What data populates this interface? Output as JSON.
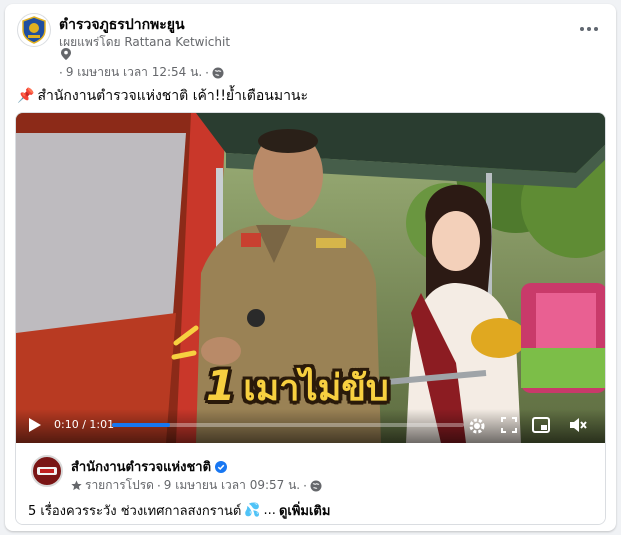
{
  "post": {
    "page_name": "ตำรวจภูธรปากพะยูน",
    "publisher": "เผยแพร่โดย Rattana Ketwichit",
    "date": "9 เมษายน เวลา 12:54 น.",
    "separator": "·",
    "pin_emoji": "📌",
    "text": "สำนักงานตำรวจแห่งชาติ  เค้า!!ย้ำเตือนมานะ"
  },
  "video": {
    "caption_number": "1",
    "caption_text": "เมาไม่ขับ",
    "time": "0:10 / 1:01",
    "progress": 0.164
  },
  "shared": {
    "page_name": "สำนักงานตำรวจแห่งชาติ",
    "audience_label": "รายการโปรด",
    "date": "9 เมษายน เวลา 09:57 น.",
    "separator": "·",
    "text": "5 เรื่องควรระวัง ช่วงเทศกาลสงกรานต์",
    "emoji": "💦",
    "ellipsis": "...",
    "see_more": "ดูเพิ่มเติม"
  },
  "icons": {
    "location": "location-pin-icon",
    "globe": "globe-icon",
    "more": "more-icon",
    "verified": "verified-badge-icon",
    "star": "star-icon",
    "play": "play-icon",
    "settings": "settings-icon",
    "fullscreen": "fullscreen-icon",
    "pip": "picture-in-picture-icon",
    "volume": "volume-icon"
  },
  "colors": {
    "accent": "#1877f2",
    "secondary_text": "#65676b",
    "caption_yellow": "#f7d040"
  }
}
